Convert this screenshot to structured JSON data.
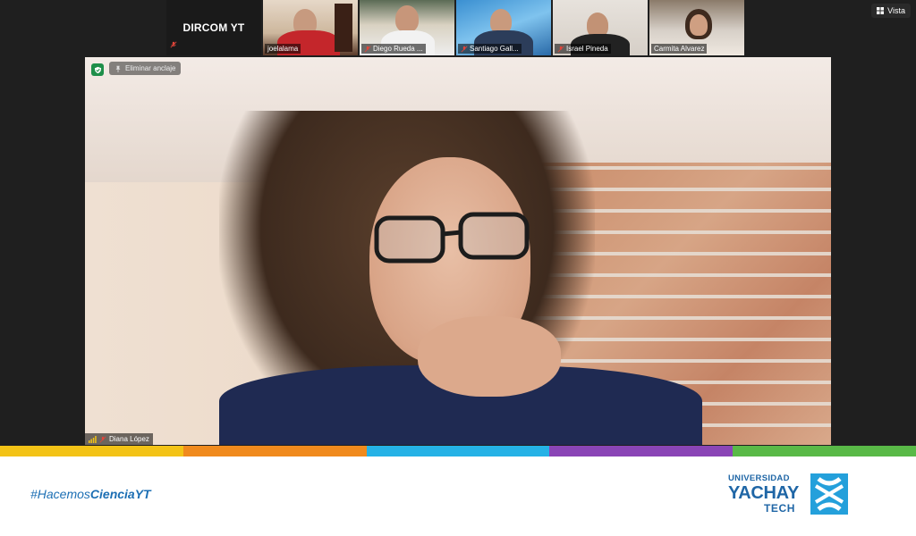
{
  "participants": [
    {
      "name": "DIRCOM YT",
      "muted": true
    },
    {
      "name": "joelalama",
      "muted": false
    },
    {
      "name": "Diego Rueda ...",
      "muted": true
    },
    {
      "name": "Santiago Gall...",
      "muted": true
    },
    {
      "name": "Israel Pineda",
      "muted": true
    },
    {
      "name": "Carmita Alvarez",
      "muted": false
    }
  ],
  "view_button": {
    "label": "Vista",
    "icon": "grid-icon"
  },
  "main_video": {
    "unpin_label": "Eliminar anclaje",
    "speaker_name": "Diana López",
    "security_icon": "shield-icon"
  },
  "colors": {
    "stripe": [
      "#f3c316",
      "#f08a1d",
      "#25b2e6",
      "#8a45b6",
      "#59b947"
    ],
    "brand": "#1f66a6",
    "hashtag": "#1c6fb4"
  },
  "banner": {
    "hashtag_prefix": "#Hacemos",
    "hashtag_bold": "CienciaYT",
    "logo_line1": "UNIVERSIDAD",
    "logo_line2": "YACHAY",
    "logo_line3": "TECH"
  }
}
